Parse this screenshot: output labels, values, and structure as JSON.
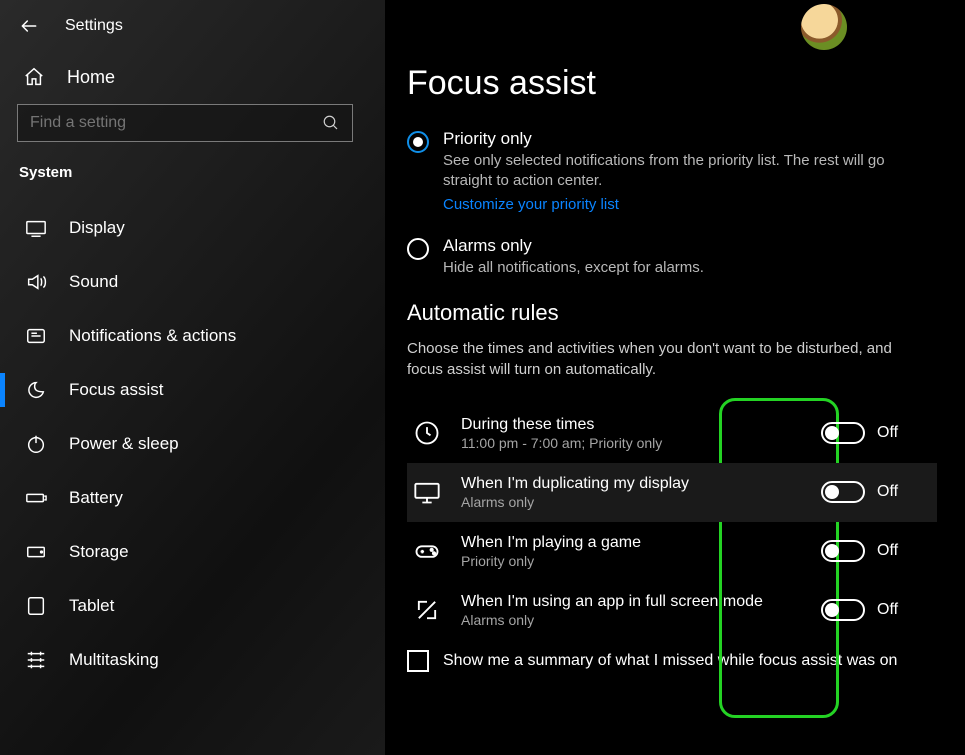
{
  "header": {
    "app_title": "Settings"
  },
  "sidebar": {
    "home_label": "Home",
    "search_placeholder": "Find a setting",
    "category_label": "System",
    "items": [
      {
        "label": "Display",
        "icon": "display-icon",
        "selected": false
      },
      {
        "label": "Sound",
        "icon": "sound-icon",
        "selected": false
      },
      {
        "label": "Notifications & actions",
        "icon": "notifications-icon",
        "selected": false
      },
      {
        "label": "Focus assist",
        "icon": "focus-assist-icon",
        "selected": true
      },
      {
        "label": "Power & sleep",
        "icon": "power-icon",
        "selected": false
      },
      {
        "label": "Battery",
        "icon": "battery-icon",
        "selected": false
      },
      {
        "label": "Storage",
        "icon": "storage-icon",
        "selected": false
      },
      {
        "label": "Tablet",
        "icon": "tablet-icon",
        "selected": false
      },
      {
        "label": "Multitasking",
        "icon": "multitasking-icon",
        "selected": false
      }
    ]
  },
  "main": {
    "page_title": "Focus assist",
    "radios": [
      {
        "label": "Priority only",
        "desc": "See only selected notifications from the priority list. The rest will go straight to action center.",
        "selected": true,
        "link": "Customize your priority list"
      },
      {
        "label": "Alarms only",
        "desc": "Hide all notifications, except for alarms.",
        "selected": false
      }
    ],
    "rules_section": {
      "title": "Automatic rules",
      "desc": "Choose the times and activities when you don't want to be disturbed, and focus assist will turn on automatically."
    },
    "rules": [
      {
        "title": "During these times",
        "sub": "11:00 pm - 7:00 am; Priority only",
        "state": "Off",
        "icon": "clock-icon"
      },
      {
        "title": "When I'm duplicating my display",
        "sub": "Alarms only",
        "state": "Off",
        "icon": "monitor-icon",
        "hover": true
      },
      {
        "title": "When I'm playing a game",
        "sub": "Priority only",
        "state": "Off",
        "icon": "gamepad-icon"
      },
      {
        "title": "When I'm using an app in full screen mode",
        "sub": "Alarms only",
        "state": "Off",
        "icon": "fullscreen-icon"
      }
    ],
    "summary_checkbox": {
      "label": "Show me a summary of what I missed while focus assist was on",
      "checked": false
    }
  }
}
